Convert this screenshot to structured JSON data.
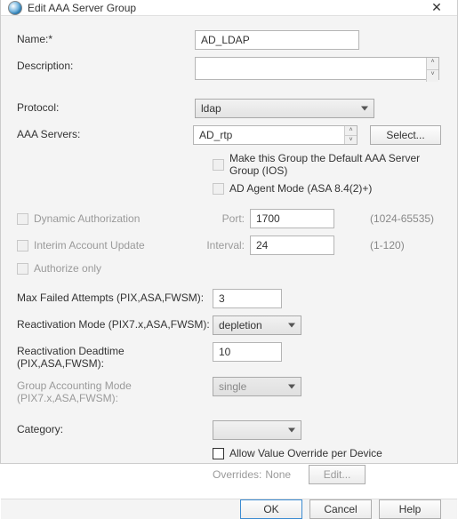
{
  "window": {
    "title": "Edit AAA Server Group"
  },
  "fields": {
    "name": {
      "label": "Name:*",
      "value": "AD_LDAP"
    },
    "description": {
      "label": "Description:",
      "value": ""
    },
    "protocol": {
      "label": "Protocol:",
      "value": "ldap"
    },
    "aaa_servers": {
      "label": "AAA Servers:",
      "value": "AD_rtp",
      "select_btn": "Select..."
    },
    "make_default": {
      "label": "Make this Group the Default AAA Server Group (IOS)"
    },
    "ad_agent": {
      "label": "AD Agent Mode (ASA 8.4(2)+)"
    },
    "dyn_auth": {
      "label": "Dynamic Authorization",
      "port_label": "Port:",
      "port_value": "1700",
      "port_range": "(1024-65535)"
    },
    "interim": {
      "label": "Interim Account Update",
      "interval_label": "Interval:",
      "interval_value": "24",
      "interval_range": "(1-120)"
    },
    "authorize_only": {
      "label": "Authorize only"
    },
    "max_failed": {
      "label": "Max Failed Attempts (PIX,ASA,FWSM):",
      "value": "3"
    },
    "reactivation_mode": {
      "label": "Reactivation Mode (PIX7.x,ASA,FWSM):",
      "value": "depletion"
    },
    "reactivation_deadtime": {
      "label": "Reactivation Deadtime (PIX,ASA,FWSM):",
      "value": "10"
    },
    "group_accounting": {
      "label": "Group Accounting Mode (PIX7.x,ASA,FWSM):",
      "value": "single"
    },
    "category": {
      "label": "Category:",
      "value": ""
    },
    "allow_override": {
      "label": "Allow Value Override per Device"
    },
    "overrides": {
      "label": "Overrides:",
      "value": "None",
      "edit_btn": "Edit..."
    }
  },
  "buttons": {
    "ok": "OK",
    "cancel": "Cancel",
    "help": "Help"
  }
}
